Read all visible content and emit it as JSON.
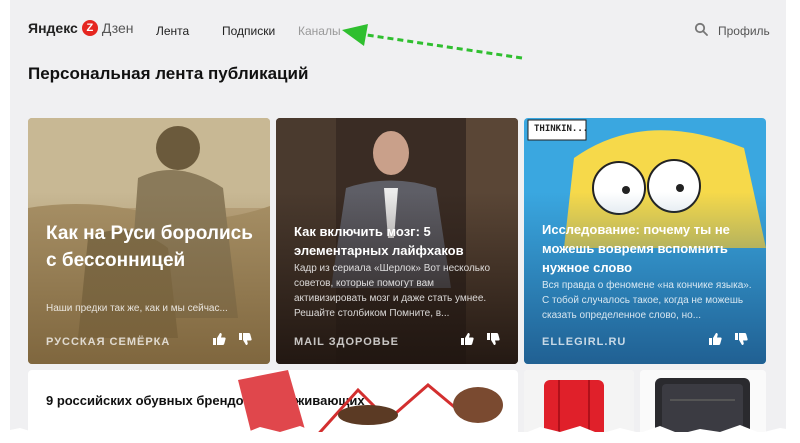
{
  "logo": {
    "brand": "Яндекс",
    "letter": "Z",
    "product": "Дзен"
  },
  "nav": [
    {
      "label": "Лента"
    },
    {
      "label": "Подписки"
    },
    {
      "label": "Каналы"
    }
  ],
  "header": {
    "profile_label": "Профиль",
    "search_icon": "search-icon"
  },
  "page_title": "Персональная лента публикаций",
  "cards": [
    {
      "title": "Как на Руси боролись с бессонницей",
      "description": "Наши предки так же, как и мы сейчас...",
      "source": "РУССКАЯ СЕМЁРКА"
    },
    {
      "title": "Как включить мозг: 5 элементарных лайфхаков",
      "description": "Кадр из сериала «Шерлок» Вот несколько советов, которые помогут вам активизировать мозг и даже стать умнее. Решайте столбиком Помните, в...",
      "source": "MAIL ЗДОРОВЬЕ"
    },
    {
      "title": "Исследование: почему ты не можешь вовремя вспомнить нужное слово",
      "description": "Вся правда о феномене «на кончике языка». С тобой случалось такое, когда не можешь сказать определенное слово, но...",
      "source": "ELLEGIRL.RU",
      "image_caption": "THINKIN..."
    }
  ],
  "row2": {
    "title": "9 российских обувных брендов, заслуживающих"
  },
  "colors": {
    "accent_red": "#e52620",
    "arrow_green": "#2fbf2f"
  }
}
